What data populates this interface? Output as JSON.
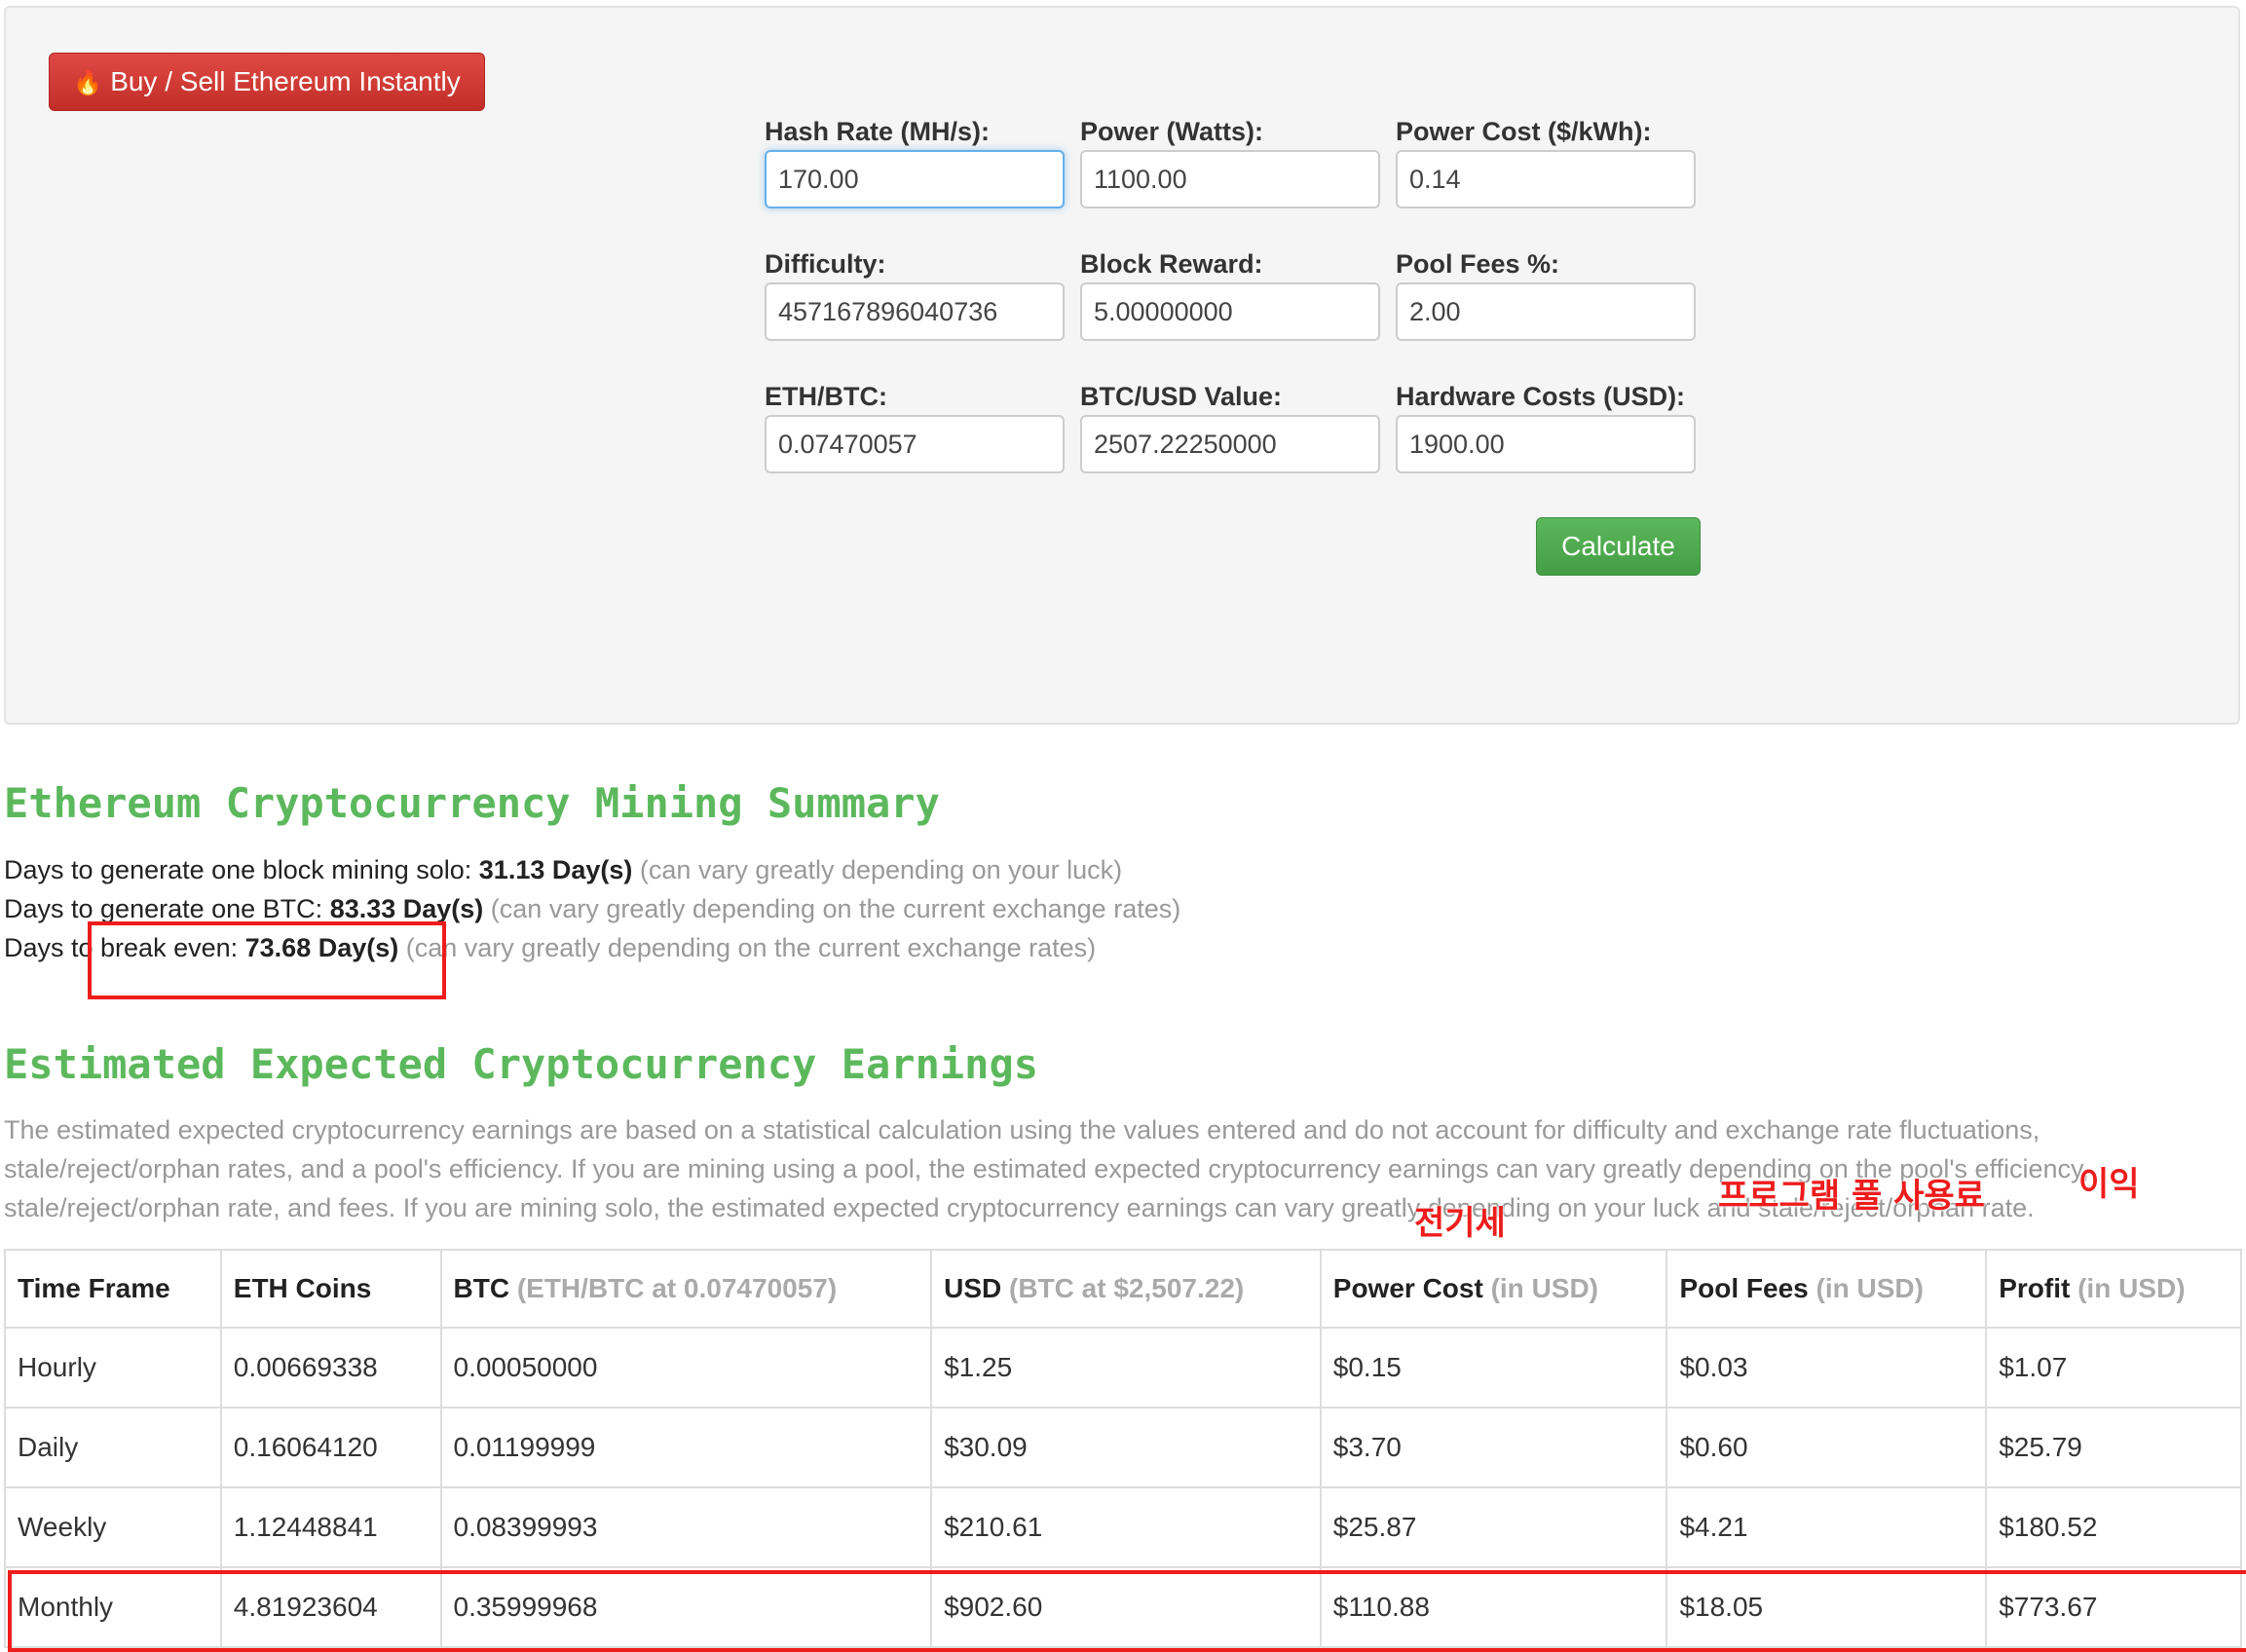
{
  "buy_button": {
    "label": "Buy / Sell Ethereum Instantly",
    "icon": "fire-icon"
  },
  "form": {
    "hash_rate": {
      "label": "Hash Rate (MH/s):",
      "value": "170.00"
    },
    "power": {
      "label": "Power (Watts):",
      "value": "1100.00"
    },
    "power_cost": {
      "label": "Power Cost ($/kWh):",
      "value": "0.14"
    },
    "difficulty": {
      "label": "Difficulty:",
      "value": "457167896040736"
    },
    "block_reward": {
      "label": "Block Reward:",
      "value": "5.00000000"
    },
    "pool_fees": {
      "label": "Pool Fees %:",
      "value": "2.00"
    },
    "eth_btc": {
      "label": "ETH/BTC:",
      "value": "0.07470057"
    },
    "btc_usd": {
      "label": "BTC/USD Value:",
      "value": "2507.22250000"
    },
    "hardware_costs": {
      "label": "Hardware Costs (USD):",
      "value": "1900.00"
    },
    "calculate_label": "Calculate"
  },
  "summary": {
    "title": "Ethereum Cryptocurrency Mining Summary",
    "lines": [
      {
        "prefix": "Days to generate one block mining solo: ",
        "value": "31.13 Day(s)",
        "note": " (can vary greatly depending on your luck)"
      },
      {
        "prefix": "Days to generate one BTC: ",
        "value": "83.33 Day(s)",
        "note": " (can vary greatly depending on the current exchange rates)"
      },
      {
        "prefix": "Days to break even: ",
        "value": "73.68 Day(s)",
        "note": " (can vary greatly depending on the current exchange rates)"
      }
    ]
  },
  "earnings": {
    "title": "Estimated Expected Cryptocurrency Earnings",
    "description": "The estimated expected cryptocurrency earnings are based on a statistical calculation using the values entered and do not account for difficulty and exchange rate fluctuations, stale/reject/orphan rates, and a pool's efficiency. If you are mining using a pool, the estimated expected cryptocurrency earnings can vary greatly depending on the pool's efficiency, stale/reject/orphan rate, and fees. If you are mining solo, the estimated expected cryptocurrency earnings can vary greatly depending on your luck and stale/reject/orphan rate.",
    "headers": [
      {
        "main": "Time Frame",
        "sub": ""
      },
      {
        "main": "ETH Coins",
        "sub": ""
      },
      {
        "main": "BTC",
        "sub": " (ETH/BTC at 0.07470057)"
      },
      {
        "main": "USD",
        "sub": " (BTC at $2,507.22)"
      },
      {
        "main": "Power Cost",
        "sub": " (in USD)"
      },
      {
        "main": "Pool Fees",
        "sub": " (in USD)"
      },
      {
        "main": "Profit",
        "sub": " (in USD)"
      }
    ],
    "rows": [
      [
        "Hourly",
        "0.00669338",
        "0.00050000",
        "$1.25",
        "$0.15",
        "$0.03",
        "$1.07"
      ],
      [
        "Daily",
        "0.16064120",
        "0.01199999",
        "$30.09",
        "$3.70",
        "$0.60",
        "$25.79"
      ],
      [
        "Weekly",
        "1.12448841",
        "0.08399993",
        "$210.61",
        "$25.87",
        "$4.21",
        "$180.52"
      ],
      [
        "Monthly",
        "4.81923604",
        "0.35999968",
        "$902.60",
        "$110.88",
        "$18.05",
        "$773.67"
      ]
    ]
  },
  "annotations": {
    "electricity": "전기세",
    "program_pool_fee": "프로그램 풀 사용료",
    "profit": "이익"
  },
  "colors": {
    "green": "#5cb85c",
    "red_button": "#d9534f",
    "annotation_red": "#ee1c1c"
  }
}
